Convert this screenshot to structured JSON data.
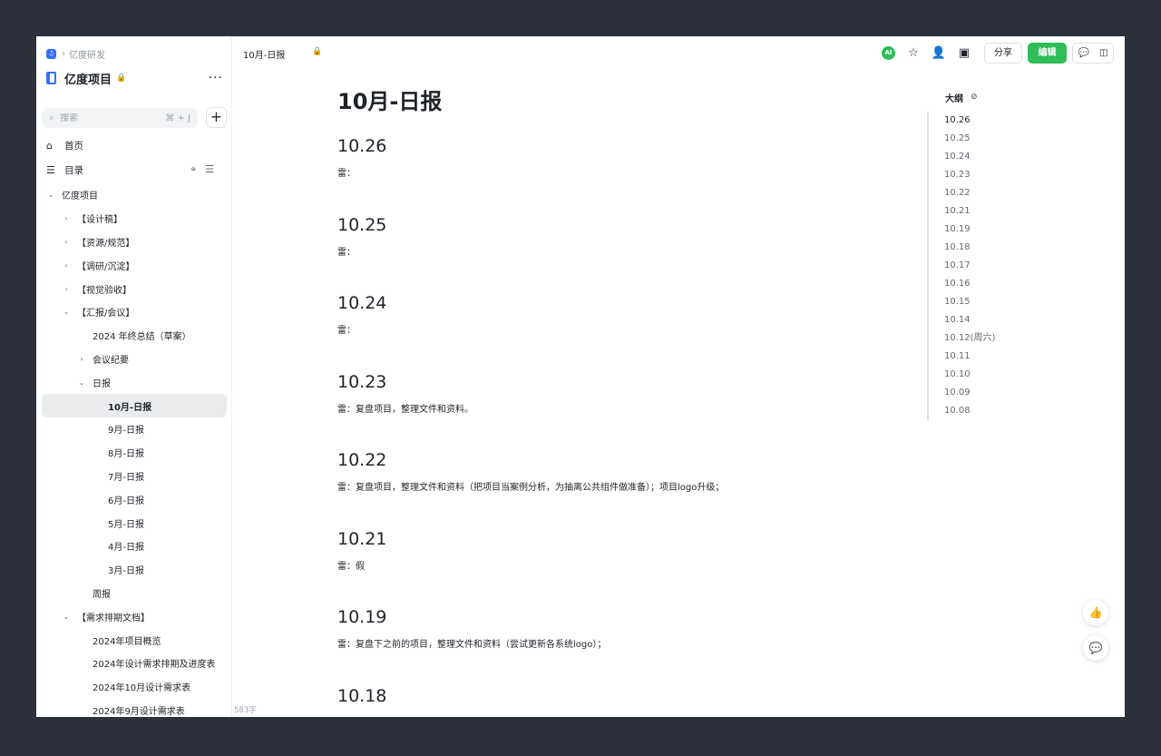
{
  "breadcrumb": {
    "space": "亿度研发"
  },
  "space": {
    "title": "亿度项目",
    "more": "···"
  },
  "search": {
    "placeholder": "搜索",
    "shortcut": "⌘ + J",
    "add": "+"
  },
  "nav": {
    "home": "首页",
    "toc": "目录"
  },
  "tree": [
    {
      "label": "亿度项目",
      "depth": 0,
      "chevron": "⌄"
    },
    {
      "label": "【设计稿】",
      "depth": 1,
      "chevron": "›"
    },
    {
      "label": "【资源/规范】",
      "depth": 1,
      "chevron": "›"
    },
    {
      "label": "【调研/沉淀】",
      "depth": 1,
      "chevron": "›"
    },
    {
      "label": "【视觉验收】",
      "depth": 1,
      "chevron": "›"
    },
    {
      "label": "【汇报/会议】",
      "depth": 1,
      "chevron": "⌄"
    },
    {
      "label": "2024 年终总结（草案）",
      "depth": 2,
      "chevron": ""
    },
    {
      "label": "会议纪要",
      "depth": 2,
      "chevron": "›"
    },
    {
      "label": "日报",
      "depth": 2,
      "chevron": "⌄"
    },
    {
      "label": "10月-日报",
      "depth": 3,
      "chevron": "",
      "active": true
    },
    {
      "label": "9月-日报",
      "depth": 3,
      "chevron": ""
    },
    {
      "label": "8月-日报",
      "depth": 3,
      "chevron": ""
    },
    {
      "label": "7月-日报",
      "depth": 3,
      "chevron": ""
    },
    {
      "label": "6月-日报",
      "depth": 3,
      "chevron": ""
    },
    {
      "label": "5月-日报",
      "depth": 3,
      "chevron": ""
    },
    {
      "label": "4月-日报",
      "depth": 3,
      "chevron": ""
    },
    {
      "label": "3月-日报",
      "depth": 3,
      "chevron": ""
    },
    {
      "label": "周报",
      "depth": 2,
      "chevron": ""
    },
    {
      "label": "【需求排期文档】",
      "depth": 1,
      "chevron": "⌄"
    },
    {
      "label": "2024年项目概览",
      "depth": 2,
      "chevron": ""
    },
    {
      "label": "2024年设计需求排期及进度表",
      "depth": 2,
      "chevron": ""
    },
    {
      "label": "2024年10月设计需求表",
      "depth": 2,
      "chevron": ""
    },
    {
      "label": "2024年9月设计需求表",
      "depth": 2,
      "chevron": ""
    }
  ],
  "topbar": {
    "doc_tab": "10月-日报",
    "ai_label": "AI",
    "share": "分享",
    "edit": "编辑"
  },
  "doc": {
    "title": "10月-日报",
    "entries": [
      {
        "heading": "10.26",
        "body": "雷："
      },
      {
        "heading": "10.25",
        "body": "雷："
      },
      {
        "heading": "10.24",
        "body": "雷："
      },
      {
        "heading": "10.23",
        "body": "雷：复盘项目，整理文件和资料。"
      },
      {
        "heading": "10.22",
        "body": "雷：复盘项目，整理文件和资料（把项目当案例分析，为抽离公共组件做准备）；项目logo升级；"
      },
      {
        "heading": "10.21",
        "body": "雷：假"
      },
      {
        "heading": "10.19",
        "body": "雷：复盘下之前的项目，整理文件和资料（尝试更新各系统logo）；"
      },
      {
        "heading": "10.18",
        "body": ""
      }
    ],
    "word_count": "583字"
  },
  "outline": {
    "title": "大纲",
    "items": [
      "10.26",
      "10.25",
      "10.24",
      "10.23",
      "10.22",
      "10.21",
      "10.19",
      "10.18",
      "10.17",
      "10.16",
      "10.15",
      "10.14",
      "10.12(周六)",
      "10.11",
      "10.10",
      "10.09",
      "10.08"
    ]
  },
  "colors": {
    "accent": "#2ebd59",
    "link": "#3370ff",
    "background": "#2b303b"
  }
}
